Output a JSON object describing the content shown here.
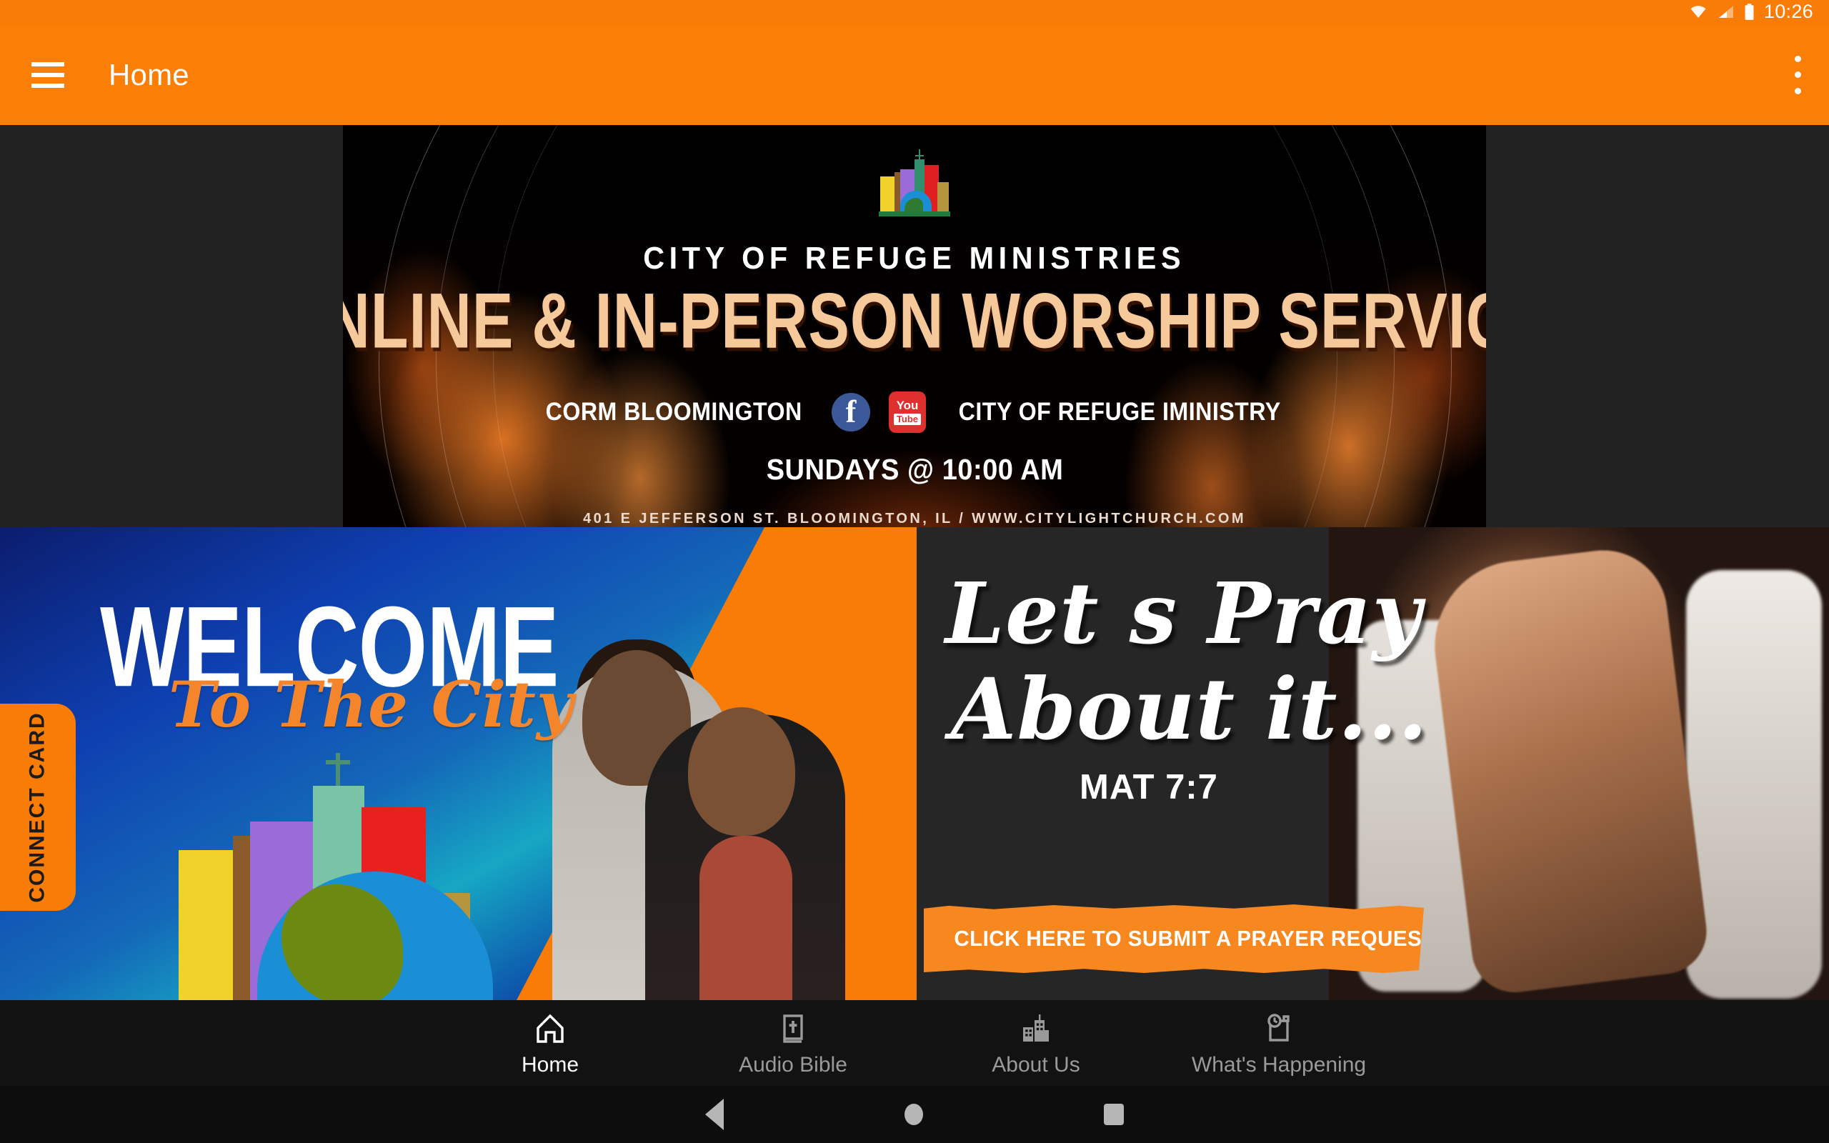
{
  "status_bar": {
    "time": "10:26",
    "icons": [
      "wifi-icon",
      "cell-signal-icon",
      "battery-icon"
    ]
  },
  "app_bar": {
    "menu_icon": "hamburger-menu-icon",
    "title": "Home",
    "overflow_icon": "kebab-menu-icon",
    "background_color": "#FB7E06"
  },
  "hero_banner": {
    "logo_alt": "city-skyline-globe-logo",
    "subtitle": "CITY OF REFUGE MINISTRIES",
    "title": "ONLINE  & IN-PERSON WORSHIP SERVICE",
    "facebook_handle": "CORM BLOOMINGTON",
    "facebook_icon": "facebook-icon",
    "youtube_icon": "youtube-icon",
    "youtube_top": "You",
    "youtube_bottom": "Tube",
    "youtube_handle": "CITY OF REFUGE IMINISTRY",
    "service_time": "SUNDAYS @ 10:00 AM",
    "address": "401 E JEFFERSON ST. BLOOMINGTON, IL / WWW.CITYLIGHTCHURCH.COM",
    "accent_color": "#F6C99A"
  },
  "welcome_card": {
    "title": "WELCOME",
    "script": "To The City",
    "connect_tab_label": "CONNECT CARD",
    "tab_color": "#F97C06",
    "image_alt": "pastor-couple-photo"
  },
  "prayer_card": {
    "title_line1": "Let s Pray",
    "title_line2": "About it...",
    "verse": "MAT 7:7",
    "cta_label": "CLICK HERE TO SUBMIT A PRAYER REQUEST TO THE PRAYER TEAM",
    "cta_color": "#F7871F",
    "image_alt": "praying-hands-photo"
  },
  "bottom_nav": {
    "items": [
      {
        "label": "Home",
        "icon": "home-icon",
        "active": true
      },
      {
        "label": "Audio Bible",
        "icon": "bible-book-icon",
        "active": false
      },
      {
        "label": "About Us",
        "icon": "church-buildings-icon",
        "active": false
      },
      {
        "label": "What's Happening",
        "icon": "clock-calendar-icon",
        "active": false
      }
    ]
  },
  "system_nav": {
    "back": "back-triangle-icon",
    "home": "home-circle-icon",
    "recents": "recents-square-icon"
  }
}
